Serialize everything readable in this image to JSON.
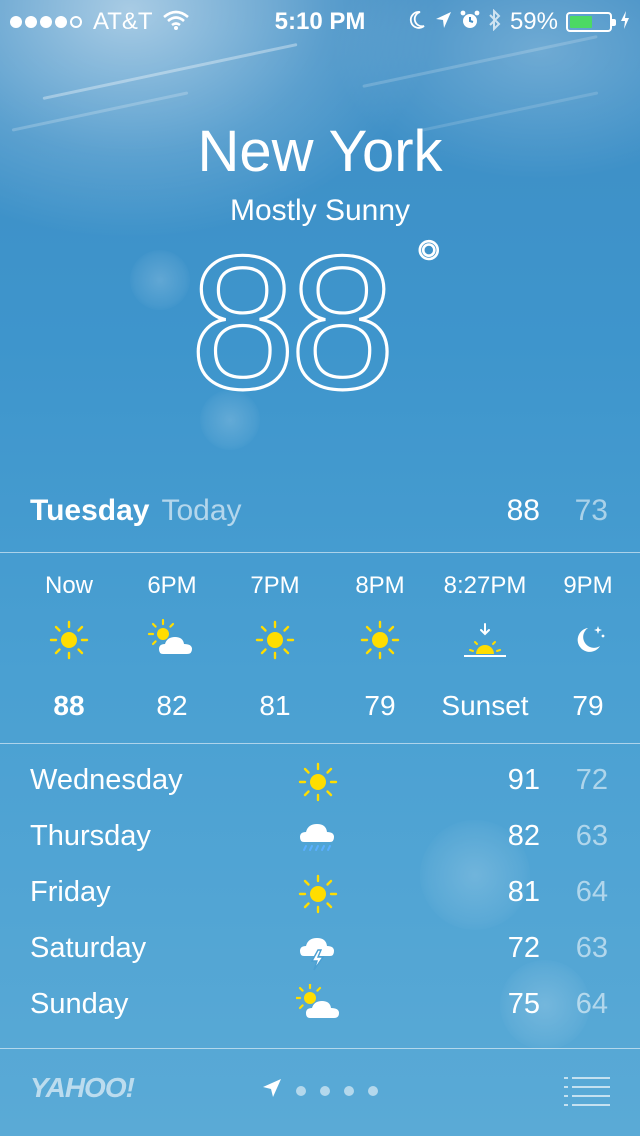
{
  "status_bar": {
    "carrier": "AT&T",
    "time": "5:10 PM",
    "battery_percent": "59%",
    "battery_level": 0.59,
    "signal_dots_filled": 4,
    "signal_dots_total": 5,
    "icons": [
      "wifi-icon",
      "moon-icon",
      "location-arrow-icon",
      "alarm-icon",
      "bluetooth-icon",
      "battery-icon",
      "charging-bolt-icon"
    ]
  },
  "location": {
    "city": "New York",
    "condition": "Mostly Sunny",
    "temperature": "88",
    "degree_symbol": "°"
  },
  "today": {
    "day": "Tuesday",
    "label": "Today",
    "high": "88",
    "low": "73"
  },
  "hourly": [
    {
      "time": "Now",
      "icon": "sun-icon",
      "temp": "88"
    },
    {
      "time": "6PM",
      "icon": "partly-cloudy-icon",
      "temp": "82"
    },
    {
      "time": "7PM",
      "icon": "sun-icon",
      "temp": "81"
    },
    {
      "time": "8PM",
      "icon": "sun-icon",
      "temp": "79"
    },
    {
      "time": "8:27PM",
      "icon": "sunset-icon",
      "temp": "Sunset"
    },
    {
      "time": "9PM",
      "icon": "moon-stars-icon",
      "temp": "79"
    }
  ],
  "daily": [
    {
      "day": "Wednesday",
      "icon": "sun-icon",
      "high": "91",
      "low": "72"
    },
    {
      "day": "Thursday",
      "icon": "rain-cloud-icon",
      "high": "82",
      "low": "63"
    },
    {
      "day": "Friday",
      "icon": "sun-icon",
      "high": "81",
      "low": "64"
    },
    {
      "day": "Saturday",
      "icon": "thunderstorm-icon",
      "high": "72",
      "low": "63"
    },
    {
      "day": "Sunday",
      "icon": "partly-cloudy-icon",
      "high": "75",
      "low": "64"
    }
  ],
  "footer": {
    "brand": "YAHOO!",
    "page_dots": 4,
    "current_location_icon": "location-arrow-icon",
    "menu_icon": "list-icon"
  },
  "colors": {
    "sun": "#ffdd00",
    "battery_fill": "#4cd964",
    "background_top": "#3f8dc4",
    "background_bottom": "#5aaad6"
  }
}
